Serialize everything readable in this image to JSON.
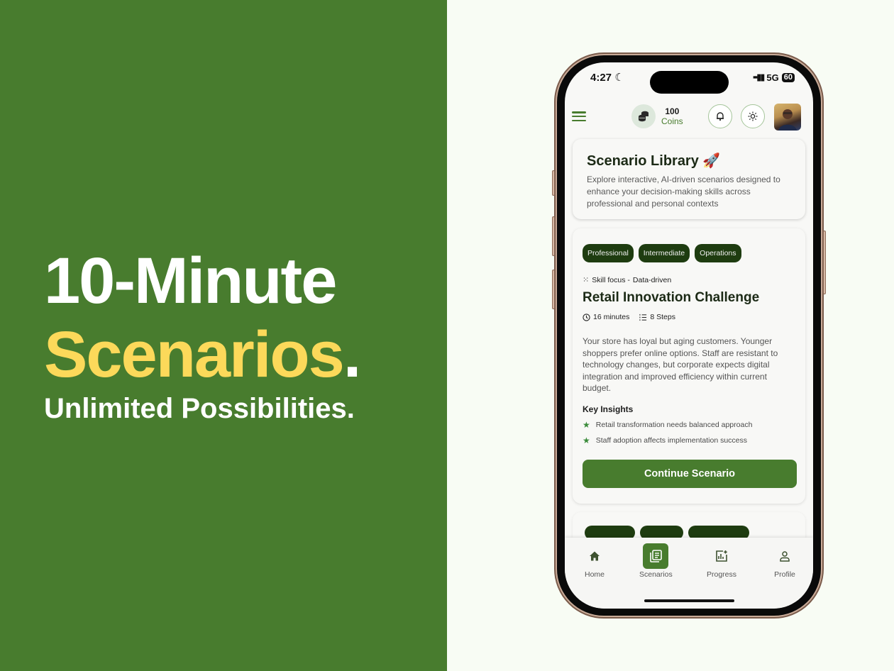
{
  "hero": {
    "line1": "10-Minute",
    "line2": "Scenarios",
    "line2_dot": ".",
    "line3": "Unlimited Possibilities."
  },
  "colors": {
    "brand_green": "#487c2e",
    "accent_yellow": "#fcd95a",
    "tag_dark_green": "#1e3c10",
    "background": "#f8fcf4"
  },
  "status_bar": {
    "time": "4:27",
    "network": "5G",
    "battery": "60"
  },
  "header": {
    "coins_value": "100",
    "coins_label": "Coins"
  },
  "library": {
    "title": "Scenario Library 🚀",
    "description": "Explore interactive, AI-driven scenarios designed to enhance your decision-making skills across professional and personal contexts"
  },
  "scenario": {
    "tags": [
      "Professional",
      "Intermediate",
      "Operations"
    ],
    "skill_label": "Skill focus -",
    "skill_value": "Data-driven",
    "title": "Retail Innovation Challenge",
    "duration": "16 minutes",
    "steps": "8 Steps",
    "description": "Your store has loyal but aging customers. Younger shoppers prefer online options. Staff are resistant to technology changes, but corporate expects digital integration and improved efficiency within current budget.",
    "insights_title": "Key Insights",
    "insights": [
      "Retail transformation needs balanced approach",
      "Staff adoption affects implementation success"
    ],
    "cta": "Continue Scenario"
  },
  "nav": {
    "items": [
      {
        "label": "Home",
        "icon": "home-icon",
        "active": false
      },
      {
        "label": "Scenarios",
        "icon": "scenarios-icon",
        "active": true
      },
      {
        "label": "Progress",
        "icon": "progress-icon",
        "active": false
      },
      {
        "label": "Profile",
        "icon": "profile-icon",
        "active": false
      }
    ]
  }
}
